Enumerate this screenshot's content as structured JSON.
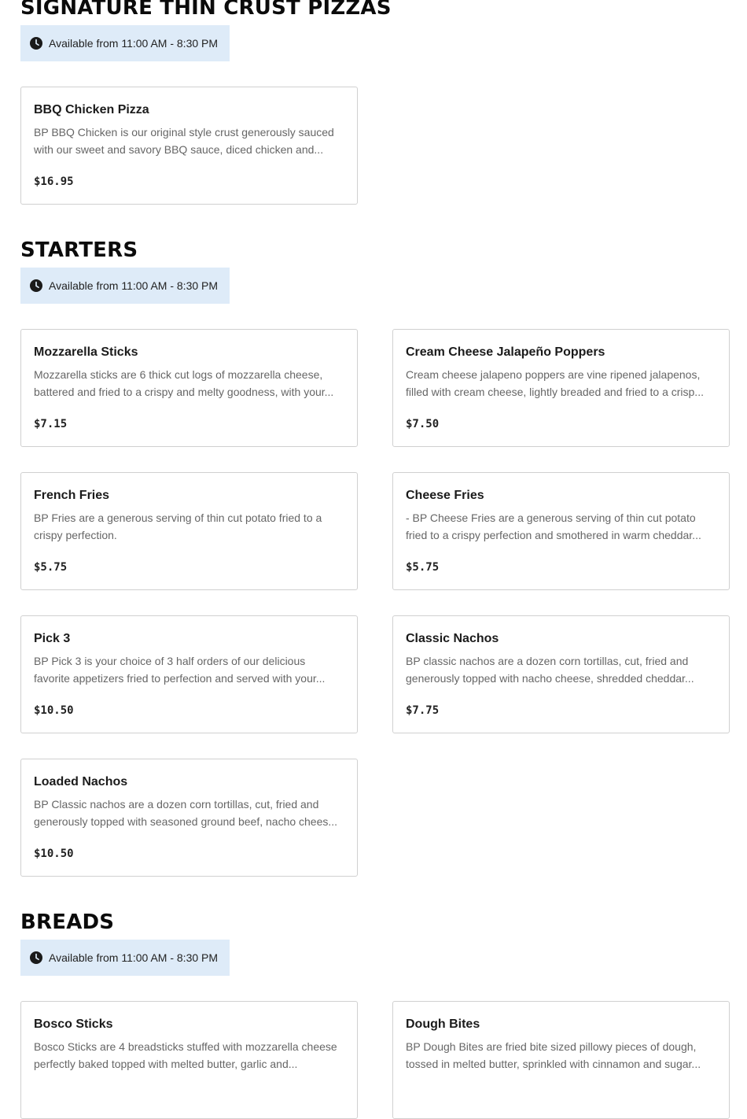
{
  "sections": [
    {
      "title": "SIGNATURE THIN CRUST PIZZAS",
      "availability": "Available from 11:00 AM - 8:30 PM",
      "items": [
        {
          "name": "BBQ Chicken Pizza",
          "description": "BP BBQ Chicken is our original style crust generously sauced with our sweet and savory BBQ sauce, diced chicken and...",
          "price": "$16.95"
        }
      ]
    },
    {
      "title": "STARTERS",
      "availability": "Available from 11:00 AM - 8:30 PM",
      "items": [
        {
          "name": "Mozzarella Sticks",
          "description": "Mozzarella sticks are 6 thick cut logs of mozzarella cheese, battered and fried to a crispy and melty goodness, with your...",
          "price": "$7.15"
        },
        {
          "name": "Cream Cheese Jalapeño Poppers",
          "description": "Cream cheese jalapeno poppers are vine ripened jalapenos, filled with cream cheese, lightly breaded and fried to a crisp...",
          "price": "$7.50"
        },
        {
          "name": "French Fries",
          "description": "BP Fries are a generous serving of thin cut potato fried to a crispy perfection.",
          "price": "$5.75"
        },
        {
          "name": "Cheese Fries",
          "description": "- BP Cheese Fries are a generous serving of thin cut potato fried to a crispy perfection and smothered in warm cheddar...",
          "price": "$5.75"
        },
        {
          "name": "Pick 3",
          "description": "BP Pick 3 is your choice of 3 half orders of our delicious favorite appetizers fried to perfection and served with your...",
          "price": "$10.50"
        },
        {
          "name": "Classic Nachos",
          "description": "BP classic nachos are a dozen corn tortillas, cut, fried and generously topped with nacho cheese, shredded cheddar...",
          "price": "$7.75"
        },
        {
          "name": "Loaded Nachos",
          "description": "BP Classic nachos are a dozen corn tortillas, cut, fried and generously topped with seasoned ground beef, nacho chees...",
          "price": "$10.50"
        }
      ]
    },
    {
      "title": "BREADS",
      "availability": "Available from 11:00 AM - 8:30 PM",
      "items": [
        {
          "name": "Bosco Sticks",
          "description": "Bosco Sticks are 4 breadsticks stuffed with mozzarella cheese perfectly baked topped with melted butter, garlic and...",
          "price": ""
        },
        {
          "name": "Dough Bites",
          "description": "BP Dough Bites are fried bite sized pillowy pieces of dough, tossed in melted butter, sprinkled with cinnamon and sugar...",
          "price": ""
        }
      ]
    }
  ],
  "icons": {
    "availability": "clock-icon"
  },
  "colors": {
    "availability_bg": "#deebf8",
    "card_border": "#d0d0d0"
  }
}
